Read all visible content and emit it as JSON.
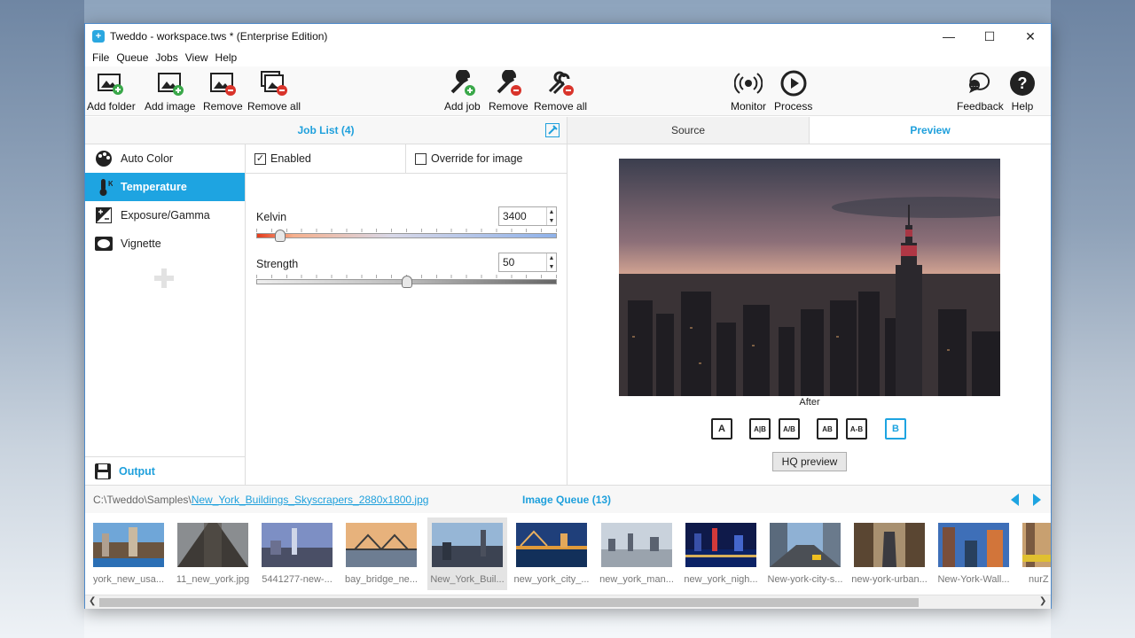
{
  "window": {
    "title": "Tweddo - workspace.tws * (Enterprise Edition)"
  },
  "menu": [
    "File",
    "Queue",
    "Jobs",
    "View",
    "Help"
  ],
  "toolbar": {
    "add_folder": "Add folder",
    "add_image": "Add image",
    "remove": "Remove",
    "remove_all": "Remove all",
    "add_job": "Add job",
    "remove_job": "Remove",
    "remove_all_jobs": "Remove all",
    "monitor": "Monitor",
    "process": "Process",
    "feedback": "Feedback",
    "help": "Help"
  },
  "job_list": {
    "title": "Job List (4)"
  },
  "effects": [
    "Auto Color",
    "Temperature",
    "Exposure/Gamma",
    "Vignette"
  ],
  "selected_effect": "Temperature",
  "output": {
    "label": "Output"
  },
  "options": {
    "enabled": "Enabled",
    "enabled_checked": true,
    "override": "Override for image",
    "override_checked": false
  },
  "params": {
    "kelvin": {
      "label": "Kelvin",
      "value": "3400",
      "level": 0.08
    },
    "strength": {
      "label": "Strength",
      "value": "50",
      "level": 0.5
    }
  },
  "tabs": {
    "source": "Source",
    "preview": "Preview",
    "active": "Preview"
  },
  "preview": {
    "caption": "After",
    "hq_button": "HQ preview"
  },
  "compare_modes": [
    "A",
    "A|B",
    "A/B",
    "AB",
    "A-B",
    "B"
  ],
  "compare_selected": "B",
  "queue": {
    "path_prefix": "C:\\Tweddo\\Samples\\",
    "path_file": "New_York_Buildings_Skyscrapers_2880x1800.jpg",
    "title": "Image Queue (13)",
    "items": [
      "york_new_usa...",
      "11_new_york.jpg",
      "5441277-new-...",
      "bay_bridge_ne...",
      "New_York_Buil...",
      "new_york_city_...",
      "new_york_man...",
      "new_york_nigh...",
      "New-york-city-s...",
      "new-york-urban...",
      "New-York-Wall...",
      "nurZ"
    ],
    "selected_index": 4
  },
  "colors": {
    "accent": "#1fa0dc",
    "selected_bg": "#1ea4e1"
  }
}
